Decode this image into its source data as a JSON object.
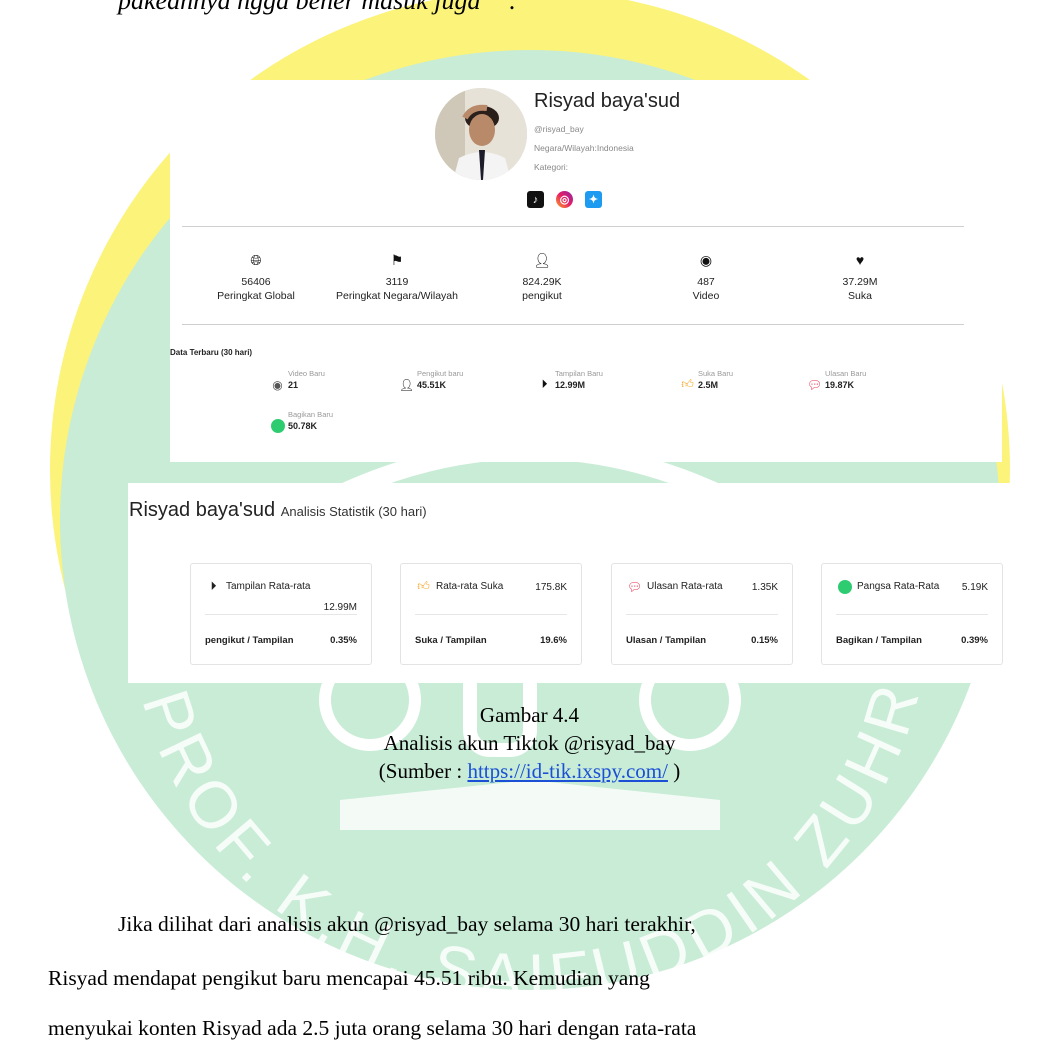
{
  "top_line": "pakeannya ngga bener masuk juga””.",
  "profile": {
    "name": "Risyad baya'sud",
    "handle": "@risyad_bay",
    "region": "Negara/Wilayah:Indonesia",
    "category": "Kategori:",
    "socials": [
      "tiktok-icon",
      "instagram-icon",
      "twitter-icon"
    ],
    "stats": [
      {
        "icon": "globe-icon",
        "value": "56406",
        "label": "Peringkat Global"
      },
      {
        "icon": "flag-icon",
        "value": "3119",
        "label": "Peringkat Negara/Wilayah"
      },
      {
        "icon": "user-icon",
        "value": "824.29K",
        "label": "pengikut"
      },
      {
        "icon": "video-icon",
        "value": "487",
        "label": "Video"
      },
      {
        "icon": "heart-icon",
        "value": "37.29M",
        "label": "Suka"
      }
    ],
    "recent": {
      "title": "Data Terbaru (30 hari)",
      "items": [
        {
          "label": "Video Baru",
          "value": "21",
          "icon": "video-icon"
        },
        {
          "label": "Pengikut baru",
          "value": "45.51K",
          "icon": "user-icon"
        },
        {
          "label": "Tampilan Baru",
          "value": "12.99M",
          "icon": "play-icon"
        },
        {
          "label": "Suka Baru",
          "value": "2.5M",
          "icon": "thumbs-up-icon"
        },
        {
          "label": "Ulasan Baru",
          "value": "19.87K",
          "icon": "comment-icon"
        },
        {
          "label": "Bagikan Baru",
          "value": "50.78K",
          "icon": "share-icon"
        }
      ]
    }
  },
  "analysis": {
    "name": "Risyad baya'sud",
    "subtitle": "Analisis Statistik (30 hari)",
    "cards": [
      {
        "icon": "play-icon",
        "title": "Tampilan Rata-rata",
        "value": "12.99M",
        "footer_label": "pengikut / Tampilan",
        "footer_value": "0.35%"
      },
      {
        "icon": "thumbs-up-icon",
        "title": "Rata-rata Suka",
        "value": "175.8K",
        "footer_label": "Suka / Tampilan",
        "footer_value": "19.6%"
      },
      {
        "icon": "comment-icon",
        "title": "Ulasan Rata-rata",
        "value": "1.35K",
        "footer_label": "Ulasan / Tampilan",
        "footer_value": "0.15%"
      },
      {
        "icon": "share-icon",
        "title": "Pangsa Rata-Rata",
        "value": "5.19K",
        "footer_label": "Bagikan / Tampilan",
        "footer_value": "0.39%"
      }
    ]
  },
  "caption": {
    "figure": "Gambar 4.4",
    "title": "Analisis akun Tiktok @risyad_bay",
    "source_prefix": "(Sumber : ",
    "source_link": "https://id-tik.ixspy.com/",
    "source_suffix": " )"
  },
  "paragraph": [
    "Jika dilihat dari analisis akun @risyad_bay selama 30 hari terakhir,",
    "Risyad mendapat pengikut baru mencapai 45.51 ribu. Kemudian yang",
    "menyukai konten Risyad ada 2.5 juta orang selama 30 hari dengan rata-rata"
  ],
  "watermark": "PROF. K.H. SAIFUDDIN ZUHRI",
  "colors": {
    "watermark_yellow": "#fbf37a",
    "watermark_green": "#c9ecd6",
    "link": "#1a4fd6",
    "thumbs": "#f5a623",
    "comment": "#e8344e",
    "share": "#2ecc71"
  }
}
